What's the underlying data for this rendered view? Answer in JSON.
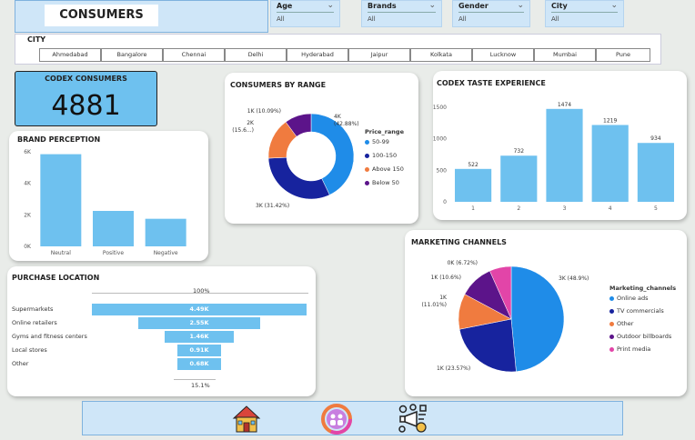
{
  "header": {
    "title": "CONSUMERS"
  },
  "slicers": [
    {
      "label": "Age",
      "value": "All"
    },
    {
      "label": "Brands",
      "value": "All"
    },
    {
      "label": "Gender",
      "value": "All"
    },
    {
      "label": "City",
      "value": "All"
    }
  ],
  "city_filter": {
    "label": "CITY",
    "options": [
      "Ahmedabad",
      "Bangalore",
      "Chennai",
      "Delhi",
      "Hyderabad",
      "Jaipur",
      "Kolkata",
      "Lucknow",
      "Mumbai",
      "Pune"
    ]
  },
  "kpi": {
    "title": "CODEX CONSUMERS",
    "value": "4881"
  },
  "colors": {
    "bar": "#6ec1ef",
    "range": [
      "#1f8ce8",
      "#17239e",
      "#f07b3f",
      "#5c148a"
    ],
    "channels": [
      "#1f8ce8",
      "#17239e",
      "#f07b3f",
      "#5c148a",
      "#e245a8"
    ]
  },
  "brand_perception": {
    "title": "BRAND PERCEPTION",
    "chart_data": {
      "type": "bar",
      "categories": [
        "Neutral",
        "Positive",
        "Negative"
      ],
      "values": [
        5850,
        2250,
        1750
      ],
      "yticks": [
        "0K",
        "2K",
        "4K",
        "6K"
      ],
      "ylim": [
        0,
        6000
      ]
    }
  },
  "consumers_by_range": {
    "title": "CONSUMERS BY RANGE",
    "chart_data": {
      "type": "pie",
      "legend_title": "Price_range",
      "labels": [
        "50-99",
        "100-150",
        "Above 150",
        "Below 50"
      ],
      "values": [
        42.88,
        31.42,
        15.6,
        10.09
      ],
      "data_labels": [
        "4K (42.88%)",
        "3K (31.42%)",
        "2K (15.6...)",
        "1K (10.09%)"
      ]
    }
  },
  "taste_experience": {
    "title": "CODEX TASTE EXPERIENCE",
    "chart_data": {
      "type": "bar",
      "categories": [
        "1",
        "2",
        "3",
        "4",
        "5"
      ],
      "values": [
        522,
        732,
        1474,
        1219,
        934
      ],
      "yticks": [
        "0",
        "500",
        "1000",
        "1500"
      ],
      "ylim": [
        0,
        1500
      ]
    }
  },
  "purchase_location": {
    "title": "PURCHASE LOCATION",
    "top_label": "100%",
    "bottom_label": "15.1%",
    "chart_data": {
      "type": "bar",
      "categories": [
        "Supermarkets",
        "Online retailers",
        "Gyms and fitness centers",
        "Local stores",
        "Other"
      ],
      "values": [
        4490,
        2550,
        1460,
        910,
        680
      ],
      "data_labels": [
        "4.49K",
        "2.55K",
        "1.46K",
        "0.91K",
        "0.68K"
      ]
    }
  },
  "marketing_channels": {
    "title": "MARKETING CHANNELS",
    "chart_data": {
      "type": "pie",
      "legend_title": "Marketing_channels",
      "labels": [
        "Online ads",
        "TV commercials",
        "Other",
        "Outdoor billboards",
        "Print media"
      ],
      "values": [
        48.9,
        23.57,
        11.01,
        10.6,
        6.72
      ],
      "data_labels": [
        "3K (48.9%)",
        "1K (23.57%)",
        "1K (11.01%)",
        "1K (10.6%)",
        "0K (6.72%)"
      ]
    }
  },
  "nav": {
    "icons": [
      "home-icon",
      "consumers-icon",
      "marketing-icon"
    ]
  }
}
